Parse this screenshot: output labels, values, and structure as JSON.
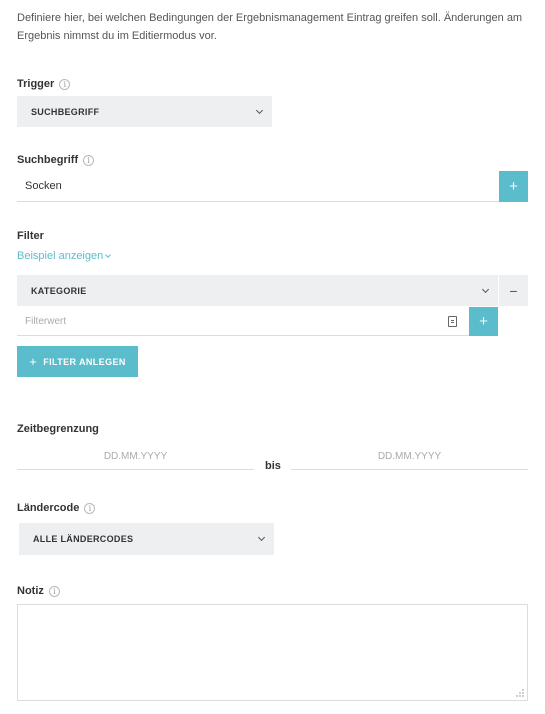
{
  "intro": {
    "text": "Definiere hier, bei welchen Bedingungen der Ergebnismanagement Eintrag greifen soll. Änderungen am Ergebnis nimmst du im Editiermodus vor."
  },
  "trigger": {
    "label": "Trigger",
    "selected": "SUCHBEGRIFF"
  },
  "search_term": {
    "label": "Suchbegriff",
    "value": "Socken",
    "add_symbol": "+"
  },
  "filter": {
    "label": "Filter",
    "example_link": "Beispiel anzeigen",
    "category_selected": "KATEGORIE",
    "remove_symbol": "−",
    "value_placeholder": "Filterwert",
    "add_symbol": "+",
    "create_button": "FILTER ANLEGEN",
    "create_symbol": "+"
  },
  "time_limit": {
    "label": "Zeitbegrenzung",
    "from_placeholder": "DD.MM.YYYY",
    "separator": "bis",
    "to_placeholder": "DD.MM.YYYY"
  },
  "country_code": {
    "label": "Ländercode",
    "selected": "ALLE LÄNDERCODES"
  },
  "note": {
    "label": "Notiz",
    "value": ""
  },
  "icons": {
    "info": "info-icon",
    "chevron": "chevron-down-icon",
    "list": "list-icon"
  },
  "colors": {
    "accent": "#5bbccb",
    "field_bg": "#eeeff1",
    "border": "#dcdcdc"
  }
}
